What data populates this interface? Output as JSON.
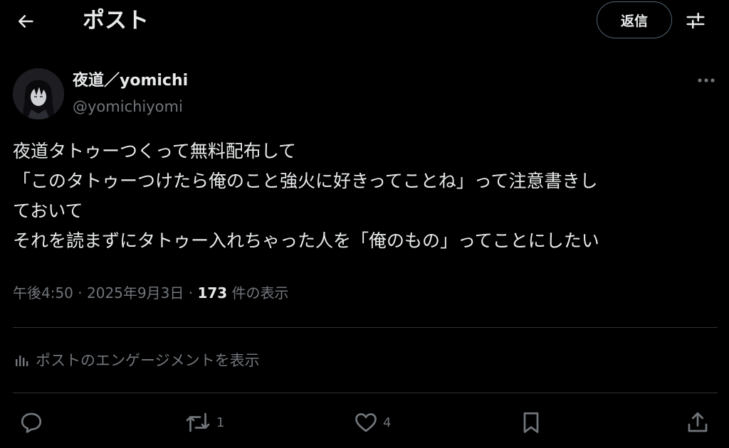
{
  "header": {
    "back_icon": "arrow-left-icon",
    "title": "ポスト",
    "reply_label": "返信",
    "settings_icon": "sliders-icon"
  },
  "author": {
    "display_name": "夜道／yomichi",
    "handle": "@yomichiyomi",
    "more_icon": "more-horizontal-icon"
  },
  "tweet": {
    "lines": [
      "夜道タトゥーつくって無料配布して",
      "「このタトゥーつけたら俺のこと強火に好きってことね」って注意書きし",
      "ておいて",
      "それを読まずにタトゥー入れちゃった人を「俺のもの」ってことにしたい"
    ]
  },
  "meta": {
    "time": "午後4:50",
    "sep1": " · ",
    "date": "2025年9月3日",
    "sep2": " · ",
    "views_count": "173",
    "views_label": " 件の表示"
  },
  "engagement": {
    "icon": "bar-chart-icon",
    "label": "ポストのエンゲージメントを表示"
  },
  "actions": {
    "reply": {
      "icon": "comment-icon",
      "count": ""
    },
    "repost": {
      "icon": "repost-icon",
      "count": "1"
    },
    "like": {
      "icon": "heart-icon",
      "count": "4"
    },
    "bookmark": {
      "icon": "bookmark-icon",
      "count": ""
    },
    "share": {
      "icon": "share-icon",
      "count": ""
    }
  },
  "colors": {
    "background": "#000000",
    "text_primary": "#e7e9ea",
    "text_secondary": "#71767b",
    "border": "#2f3336"
  }
}
